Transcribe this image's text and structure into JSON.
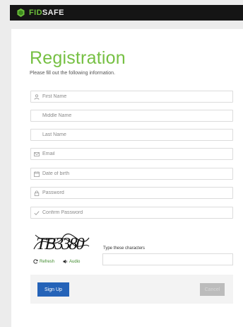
{
  "header": {
    "brand_part1": "FID",
    "brand_part2": "SAFE",
    "logo_color": "#6cbf3b"
  },
  "form": {
    "title": "Registration",
    "subtitle": "Please fill out the following information.",
    "fields": [
      {
        "placeholder": "First Name",
        "icon": "user-icon"
      },
      {
        "placeholder": "Middle Name",
        "icon": ""
      },
      {
        "placeholder": "Last Name",
        "icon": ""
      },
      {
        "placeholder": "Email",
        "icon": "envelope-icon"
      },
      {
        "placeholder": "Date of birth",
        "icon": "calendar-icon"
      },
      {
        "placeholder": "Password",
        "icon": "lock-icon"
      },
      {
        "placeholder": "Confirm Password",
        "icon": "check-icon"
      }
    ]
  },
  "captcha": {
    "image_text": "TB3380",
    "refresh_label": "Refresh",
    "audio_label": "Audio",
    "prompt": "Type these characters",
    "value": ""
  },
  "actions": {
    "signup_label": "Sign Up",
    "cancel_label": "Cancel",
    "primary_color": "#2563b8",
    "accent_color": "#76c043"
  }
}
